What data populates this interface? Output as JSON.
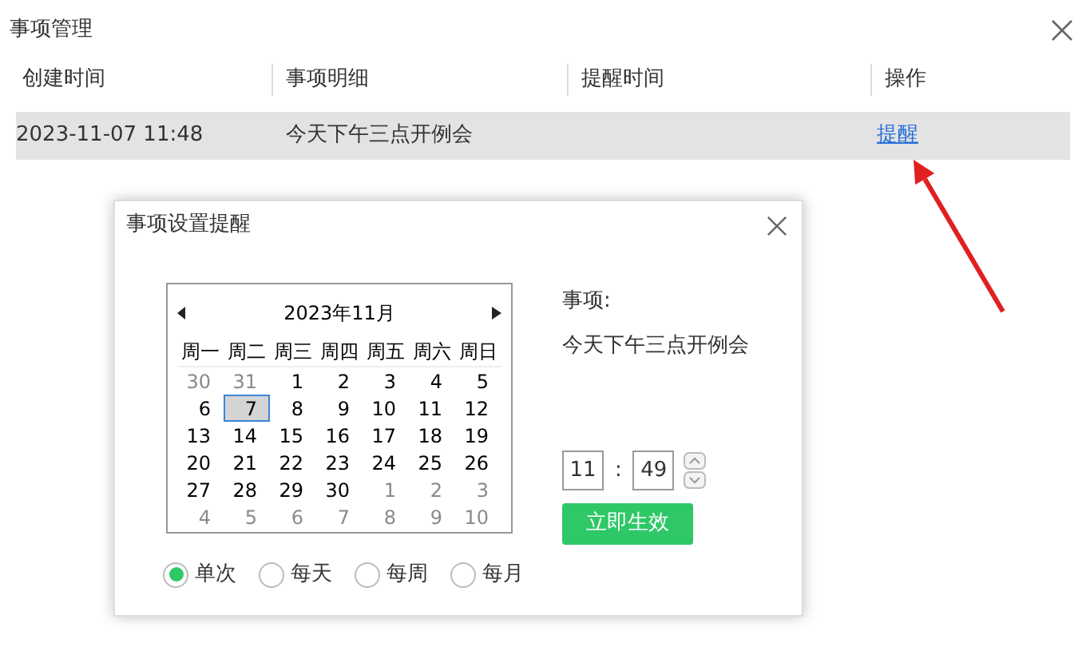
{
  "window": {
    "title": "事项管理"
  },
  "table": {
    "columns": [
      "创建时间",
      "事项明细",
      "提醒时间",
      "操作"
    ],
    "rows": [
      {
        "created": "2023-11-07 11:48",
        "detail": "今天下午三点开例会",
        "remind_time": "",
        "action": "提醒",
        "selected": true
      }
    ]
  },
  "dialog": {
    "title": "事项设置提醒",
    "calendar": {
      "title": "2023年11月",
      "weekdays": [
        "周一",
        "周二",
        "周三",
        "周四",
        "周五",
        "周六",
        "周日"
      ],
      "days": [
        {
          "label": "30",
          "muted": true,
          "selected": false
        },
        {
          "label": "31",
          "muted": true,
          "selected": false
        },
        {
          "label": "1",
          "muted": false,
          "selected": false
        },
        {
          "label": "2",
          "muted": false,
          "selected": false
        },
        {
          "label": "3",
          "muted": false,
          "selected": false
        },
        {
          "label": "4",
          "muted": false,
          "selected": false
        },
        {
          "label": "5",
          "muted": false,
          "selected": false
        },
        {
          "label": "6",
          "muted": false,
          "selected": false
        },
        {
          "label": "7",
          "muted": false,
          "selected": true
        },
        {
          "label": "8",
          "muted": false,
          "selected": false
        },
        {
          "label": "9",
          "muted": false,
          "selected": false
        },
        {
          "label": "10",
          "muted": false,
          "selected": false
        },
        {
          "label": "11",
          "muted": false,
          "selected": false
        },
        {
          "label": "12",
          "muted": false,
          "selected": false
        },
        {
          "label": "13",
          "muted": false,
          "selected": false
        },
        {
          "label": "14",
          "muted": false,
          "selected": false
        },
        {
          "label": "15",
          "muted": false,
          "selected": false
        },
        {
          "label": "16",
          "muted": false,
          "selected": false
        },
        {
          "label": "17",
          "muted": false,
          "selected": false
        },
        {
          "label": "18",
          "muted": false,
          "selected": false
        },
        {
          "label": "19",
          "muted": false,
          "selected": false
        },
        {
          "label": "20",
          "muted": false,
          "selected": false
        },
        {
          "label": "21",
          "muted": false,
          "selected": false
        },
        {
          "label": "22",
          "muted": false,
          "selected": false
        },
        {
          "label": "23",
          "muted": false,
          "selected": false
        },
        {
          "label": "24",
          "muted": false,
          "selected": false
        },
        {
          "label": "25",
          "muted": false,
          "selected": false
        },
        {
          "label": "26",
          "muted": false,
          "selected": false
        },
        {
          "label": "27",
          "muted": false,
          "selected": false
        },
        {
          "label": "28",
          "muted": false,
          "selected": false
        },
        {
          "label": "29",
          "muted": false,
          "selected": false
        },
        {
          "label": "30",
          "muted": false,
          "selected": false
        },
        {
          "label": "1",
          "muted": true,
          "selected": false
        },
        {
          "label": "2",
          "muted": true,
          "selected": false
        },
        {
          "label": "3",
          "muted": true,
          "selected": false
        },
        {
          "label": "4",
          "muted": true,
          "selected": false
        },
        {
          "label": "5",
          "muted": true,
          "selected": false
        },
        {
          "label": "6",
          "muted": true,
          "selected": false
        },
        {
          "label": "7",
          "muted": true,
          "selected": false
        },
        {
          "label": "8",
          "muted": true,
          "selected": false
        },
        {
          "label": "9",
          "muted": true,
          "selected": false
        },
        {
          "label": "10",
          "muted": true,
          "selected": false
        }
      ]
    },
    "item_label": "事项:",
    "item_text": "今天下午三点开例会",
    "hour": "11",
    "colon": ":",
    "minute": "49",
    "apply_button": "立即生效",
    "repeat_options": [
      {
        "label": "单次",
        "selected": true
      },
      {
        "label": "每天",
        "selected": false
      },
      {
        "label": "每周",
        "selected": false
      },
      {
        "label": "每月",
        "selected": false
      }
    ]
  }
}
